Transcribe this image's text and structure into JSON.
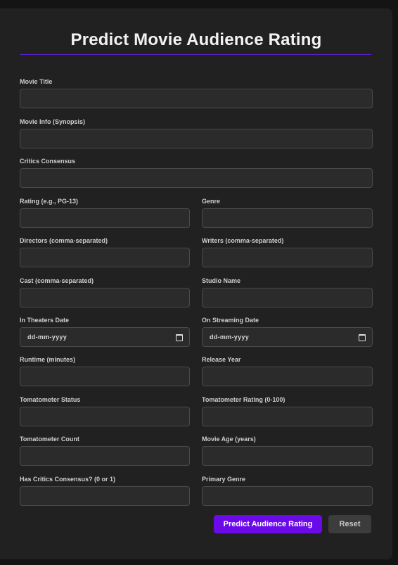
{
  "form": {
    "title": "Predict Movie Audience Rating",
    "accent_color": "#6a0ae8",
    "fields": {
      "movie_title": {
        "label": "Movie Title",
        "value": ""
      },
      "movie_info": {
        "label": "Movie Info (Synopsis)",
        "value": ""
      },
      "critics_consensus": {
        "label": "Critics Consensus",
        "value": ""
      },
      "rating": {
        "label": "Rating (e.g., PG-13)",
        "value": ""
      },
      "genre": {
        "label": "Genre",
        "value": ""
      },
      "directors": {
        "label": "Directors (comma-separated)",
        "value": ""
      },
      "writers": {
        "label": "Writers (comma-separated)",
        "value": ""
      },
      "cast": {
        "label": "Cast (comma-separated)",
        "value": ""
      },
      "studio_name": {
        "label": "Studio Name",
        "value": ""
      },
      "in_theaters_date": {
        "label": "In Theaters Date",
        "value": "dd-mm-yyyy"
      },
      "on_streaming_date": {
        "label": "On Streaming Date",
        "value": "dd-mm-yyyy"
      },
      "runtime": {
        "label": "Runtime (minutes)",
        "value": ""
      },
      "release_year": {
        "label": "Release Year",
        "value": ""
      },
      "tomatometer_status": {
        "label": "Tomatometer Status",
        "value": ""
      },
      "tomatometer_rating": {
        "label": "Tomatometer Rating (0-100)",
        "value": ""
      },
      "tomatometer_count": {
        "label": "Tomatometer Count",
        "value": ""
      },
      "movie_age": {
        "label": "Movie Age (years)",
        "value": ""
      },
      "has_critics_consensus": {
        "label": "Has Critics Consensus? (0 or 1)",
        "value": ""
      },
      "primary_genre": {
        "label": "Primary Genre",
        "value": ""
      }
    },
    "buttons": {
      "predict_label": "Predict Audience Rating",
      "reset_label": "Reset"
    }
  }
}
